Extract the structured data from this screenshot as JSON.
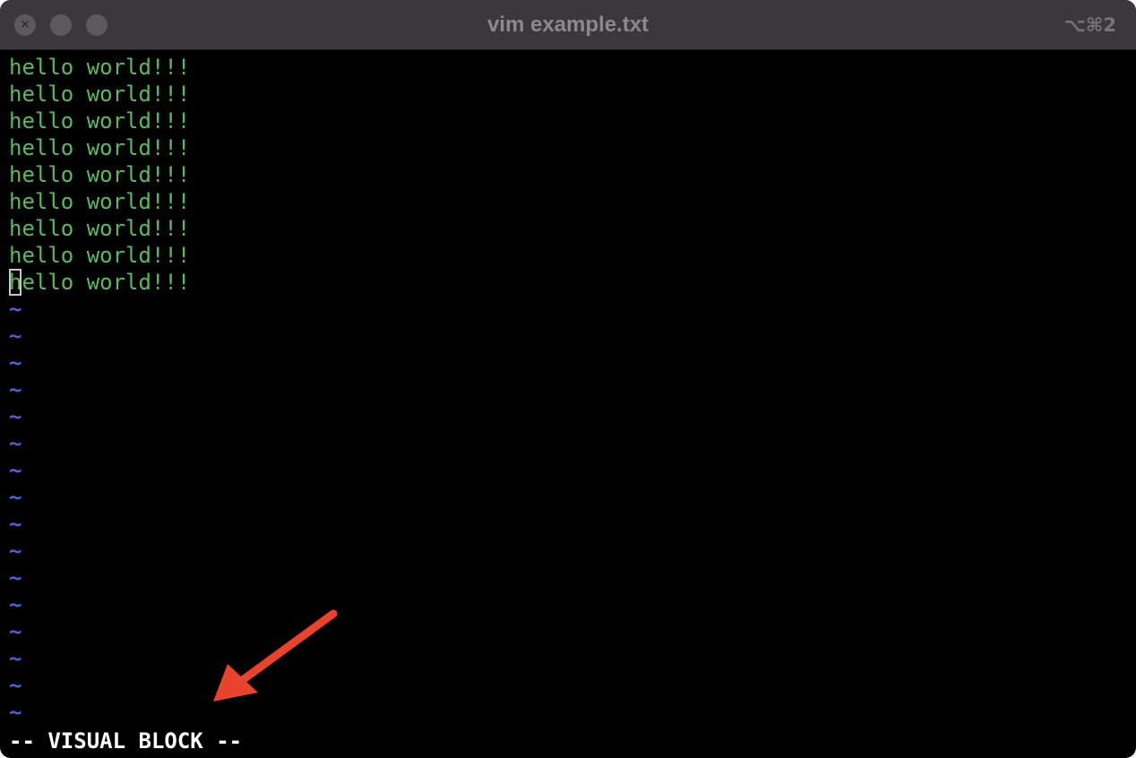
{
  "window": {
    "title": "vim example.txt",
    "shortcut": "⌥⌘2",
    "close_glyph": "×"
  },
  "buffer": {
    "lines": [
      "hello world!!!",
      "hello world!!!",
      "hello world!!!",
      "hello world!!!",
      "hello world!!!",
      "hello world!!!",
      "hello world!!!",
      "hello world!!!",
      "hello world!!!"
    ],
    "cursor_line_first_char": "h",
    "cursor_line_rest": "ello world!!!",
    "empty_line_marker": "~",
    "empty_line_count": 16
  },
  "status": {
    "mode": "-- VISUAL BLOCK --"
  },
  "colors": {
    "text": "#5cba5e",
    "tilde": "#4a64d6",
    "status": "#ffffff",
    "background": "#000000",
    "arrow": "#e8432d"
  },
  "annotation": {
    "icon": "red-arrow-icon"
  }
}
